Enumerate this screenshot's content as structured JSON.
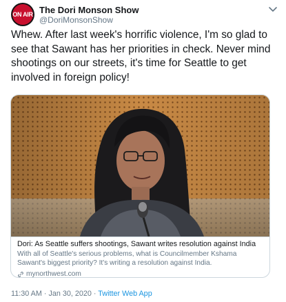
{
  "author": {
    "display_name": "The Dori Monson Show",
    "handle": "@DoriMonsonShow",
    "avatar_text": "ON AIR",
    "avatar_icon": "on-air-logo"
  },
  "tweet": {
    "text": "Whew. After last week's horrific violence, I'm so glad to see that Sawant has her priorities in check. Never mind shootings on our streets, it's time for Seattle to get involved in foreign policy!"
  },
  "card": {
    "title": "Dori: As Seattle suffers shootings, Sawant writes resolution against India",
    "description": "With all of Seattle's serious problems, what is Councilmember Kshama Sawant's biggest priority? It's writing a resolution against India.",
    "domain": "mynorthwest.com",
    "link_icon": "link-icon"
  },
  "meta": {
    "time": "11:30 AM",
    "separator1": " · ",
    "date": "Jan 30, 2020",
    "separator2": " · ",
    "source": "Twitter Web App"
  },
  "colors": {
    "text": "#14171a",
    "secondary": "#657786",
    "accent": "#1b95e0",
    "border": "#ccd6dd",
    "avatar_red": "#c8102e"
  }
}
